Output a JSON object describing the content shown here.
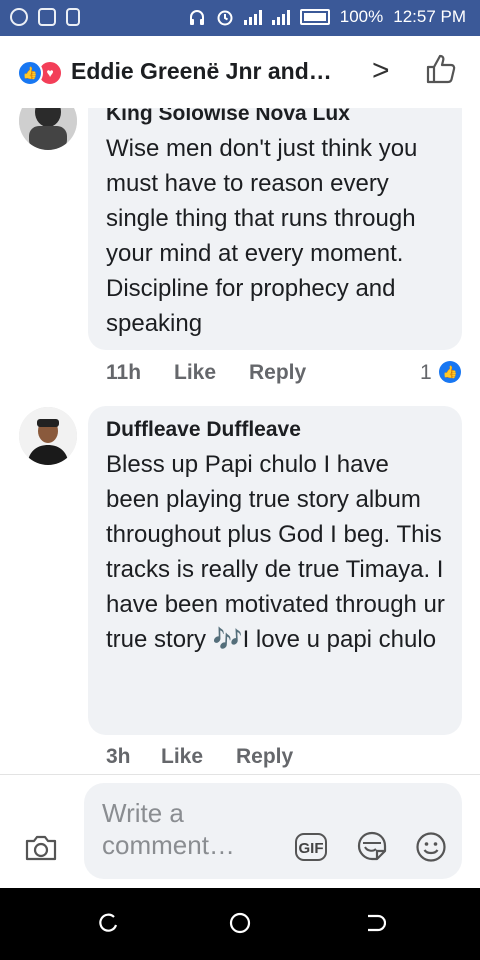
{
  "status_bar": {
    "battery_percent": "100%",
    "time": "12:57 PM",
    "left_icons": [
      "whatsapp-icon",
      "message-icon",
      "sim-icon"
    ],
    "right_icons": [
      "headphones-icon",
      "alarm-icon",
      "signal-icon",
      "signal-icon",
      "battery-icon"
    ]
  },
  "header": {
    "title": "Eddie Greenë Jnr and…",
    "reactions": [
      "like-reaction-icon",
      "love-reaction-icon"
    ],
    "chevron": ">",
    "like_icon": "thumbs-up-outline-icon"
  },
  "comments": [
    {
      "author": "King Solowise Nova Lux",
      "text": "Wise men don't just think you must have to reason every single thing that runs through your mind at every moment. Discipline for prophecy and speaking",
      "time": "11h",
      "like_label": "Like",
      "reply_label": "Reply",
      "reactions_count": "1"
    },
    {
      "author": "Duffleave Duffleave",
      "text": "Bless up Papi chulo I have been playing true story album throughout plus God I beg. This tracks is really de true Timaya. I have been motivated through ur true story 🎶I love u papi chulo",
      "time": "3h",
      "like_label": "Like",
      "reply_label": "Reply"
    }
  ],
  "composer": {
    "placeholder": "Write a comment…",
    "gif_label": "GIF",
    "icons": [
      "camera-icon",
      "gif-icon",
      "sticker-icon",
      "emoji-icon"
    ]
  },
  "nav_bar": {
    "icons": [
      "recent-apps-icon",
      "home-icon",
      "back-icon"
    ]
  },
  "colors": {
    "status_bar_bg": "#3b5998",
    "bubble_bg": "#f0f2f5",
    "like_blue": "#1877f2",
    "love_red": "#f33e58",
    "meta_gray": "#65676b"
  }
}
